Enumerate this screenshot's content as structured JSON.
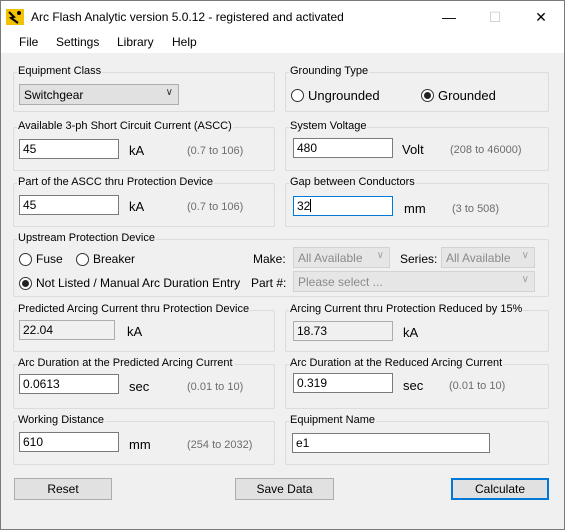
{
  "window": {
    "title": "Arc Flash Analytic version 5.0.12 - registered and activated",
    "icon": "arc-flash-app-icon",
    "minimize_glyph": "—",
    "maximize_glyph": "☐",
    "close_glyph": "✕"
  },
  "menu": [
    "File",
    "Settings",
    "Library",
    "Help"
  ],
  "equipment_class": {
    "label": "Equipment Class",
    "value": "Switchgear"
  },
  "grounding": {
    "label": "Grounding Type",
    "options": [
      "Ungrounded",
      "Grounded"
    ],
    "selected": "Grounded"
  },
  "ascc": {
    "label": "Available 3-ph Short Circuit Current (ASCC)",
    "value": "45",
    "unit": "kA",
    "range": "(0.7 to 106)"
  },
  "voltage": {
    "label": "System Voltage",
    "value": "480",
    "unit": "Volt",
    "range": "(208 to 46000)"
  },
  "part_ascc": {
    "label": "Part of the ASCC thru Protection Device",
    "value": "45",
    "unit": "kA",
    "range": "(0.7 to 106)"
  },
  "gap": {
    "label": "Gap between Conductors",
    "value": "32",
    "unit": "mm",
    "range": "(3 to 508)"
  },
  "upstream": {
    "label": "Upstream Protection Device",
    "options": [
      "Fuse",
      "Breaker",
      "Not Listed / Manual Arc Duration Entry"
    ],
    "selected": "Not Listed / Manual Arc Duration Entry",
    "make_label": "Make:",
    "make_value": "All Available",
    "series_label": "Series:",
    "series_value": "All Available",
    "part_label": "Part #:",
    "part_placeholder": "Please select ..."
  },
  "predicted_arcing": {
    "label": "Predicted Arcing Current thru Protection Device",
    "value": "22.04",
    "unit": "kA"
  },
  "reduced_arcing": {
    "label": "Arcing Current thru Protection Reduced by 15%",
    "value": "18.73",
    "unit": "kA"
  },
  "arc_duration_pred": {
    "label": "Arc Duration at the Predicted Arcing Current",
    "value": "0.0613",
    "unit": "sec",
    "range": "(0.01 to 10)"
  },
  "arc_duration_red": {
    "label": "Arc Duration at the Reduced Arcing Current",
    "value": "0.319",
    "unit": "sec",
    "range": "(0.01 to 10)"
  },
  "working_distance": {
    "label": "Working Distance",
    "value": "610",
    "unit": "mm",
    "range": "(254 to 2032)"
  },
  "equipment_name": {
    "label": "Equipment Name",
    "value": "e1"
  },
  "buttons": {
    "reset": "Reset",
    "save": "Save Data",
    "calculate": "Calculate"
  }
}
